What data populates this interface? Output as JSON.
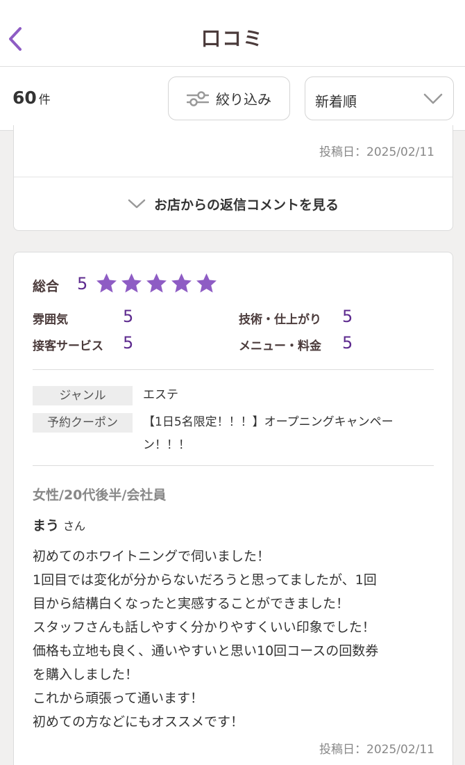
{
  "header": {
    "title": "口コミ"
  },
  "toolbar": {
    "count_value": "60",
    "count_unit": "件",
    "filter_label": "絞り込み",
    "sort_selected": "新着順"
  },
  "previous_review": {
    "posted_date": "投稿日：2025/02/11",
    "reply_link_label": "お店からの返信コメントを見る"
  },
  "review": {
    "overall_label": "総合",
    "overall_score": "5",
    "stars": 5,
    "ratings": [
      {
        "label": "雰囲気",
        "value": "5"
      },
      {
        "label": "技術・仕上がり",
        "value": "5"
      },
      {
        "label": "接客サービス",
        "value": "5"
      },
      {
        "label": "メニュー・料金",
        "value": "5"
      }
    ],
    "genre_label": "ジャンル",
    "genre_value": "エステ",
    "coupon_label": "予約クーポン",
    "coupon_value": "【1日5名限定！！！】オープニングキャンペーン！！！",
    "reviewer_attributes": "女性/20代後半/会社員",
    "reviewer_name": "まう",
    "reviewer_suffix": "さん",
    "body": [
      "初めてのホワイトニングで伺いました！",
      "1回目では変化が分からないだろうと思ってましたが、1回",
      "目から結構白くなったと実感することができました！",
      "スタッフさんも話しやすく分かりやすくいい印象でした！",
      "価格も立地も良く、通いやすいと思い10回コースの回数券",
      "を購入しました！",
      "これから頑張って通います！",
      "初めての方などにもオススメです！"
    ],
    "posted_date": "投稿日：2025/02/11"
  },
  "colors": {
    "accent": "#8e5cc4",
    "score": "#5d2a8e",
    "star": "#8e5cc4",
    "title": "#4b3b3b"
  },
  "icons": {
    "back": "chevron-left-icon",
    "filter": "sliders-icon",
    "sort": "chevron-down-icon",
    "reply": "chevron-down-icon",
    "star": "star-icon"
  }
}
